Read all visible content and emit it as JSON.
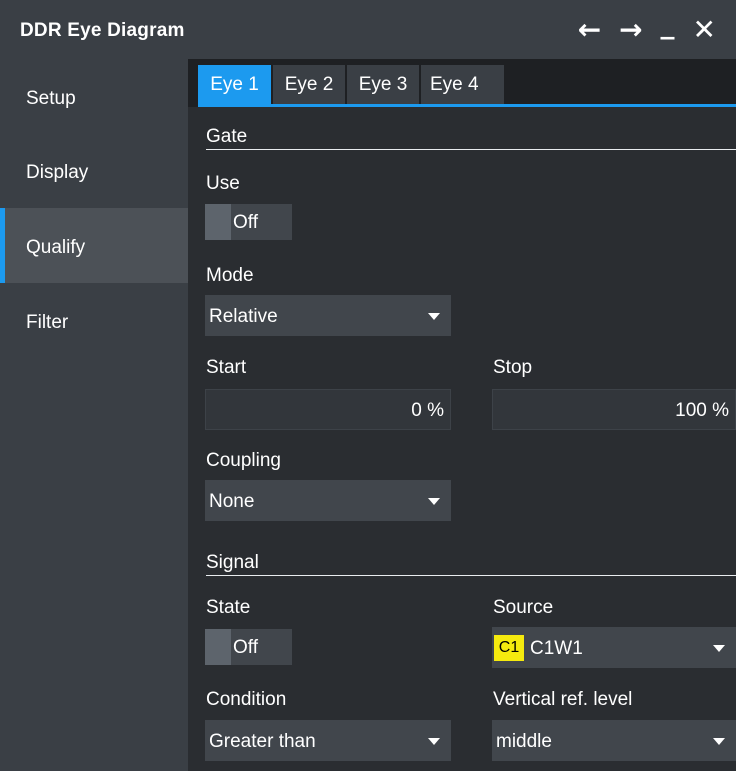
{
  "window": {
    "title": "DDR Eye Diagram"
  },
  "titlebar_icons": [
    "arrow-left-icon",
    "arrow-right-icon",
    "minimize-icon",
    "close-icon"
  ],
  "titlebar_glyphs": {
    "back": "←",
    "forward": "→",
    "minimize": "_",
    "close": "✕"
  },
  "sidebar": {
    "items": [
      {
        "label": "Setup"
      },
      {
        "label": "Display"
      },
      {
        "label": "Qualify"
      },
      {
        "label": "Filter"
      }
    ],
    "active": "Qualify"
  },
  "tabs": {
    "items": [
      {
        "label": "Eye 1"
      },
      {
        "label": "Eye 2"
      },
      {
        "label": "Eye 3"
      },
      {
        "label": "Eye 4"
      }
    ],
    "active": "Eye 1"
  },
  "gate": {
    "section_title": "Gate",
    "use_label": "Use",
    "use_value": "Off",
    "mode_label": "Mode",
    "mode_value": "Relative",
    "start_label": "Start",
    "start_value": "0 %",
    "stop_label": "Stop",
    "stop_value": "100 %",
    "coupling_label": "Coupling",
    "coupling_value": "None"
  },
  "signal": {
    "section_title": "Signal",
    "state_label": "State",
    "state_value": "Off",
    "source_label": "Source",
    "source_badge": "C1",
    "source_value": "C1W1",
    "condition_label": "Condition",
    "condition_value": "Greater than",
    "vref_label": "Vertical ref. level",
    "vref_value": "middle"
  },
  "colors": {
    "accent": "#1c9aef",
    "source_badge": "#f5ea0e",
    "panel": "#3a3f45",
    "background": "#2a2d31"
  }
}
